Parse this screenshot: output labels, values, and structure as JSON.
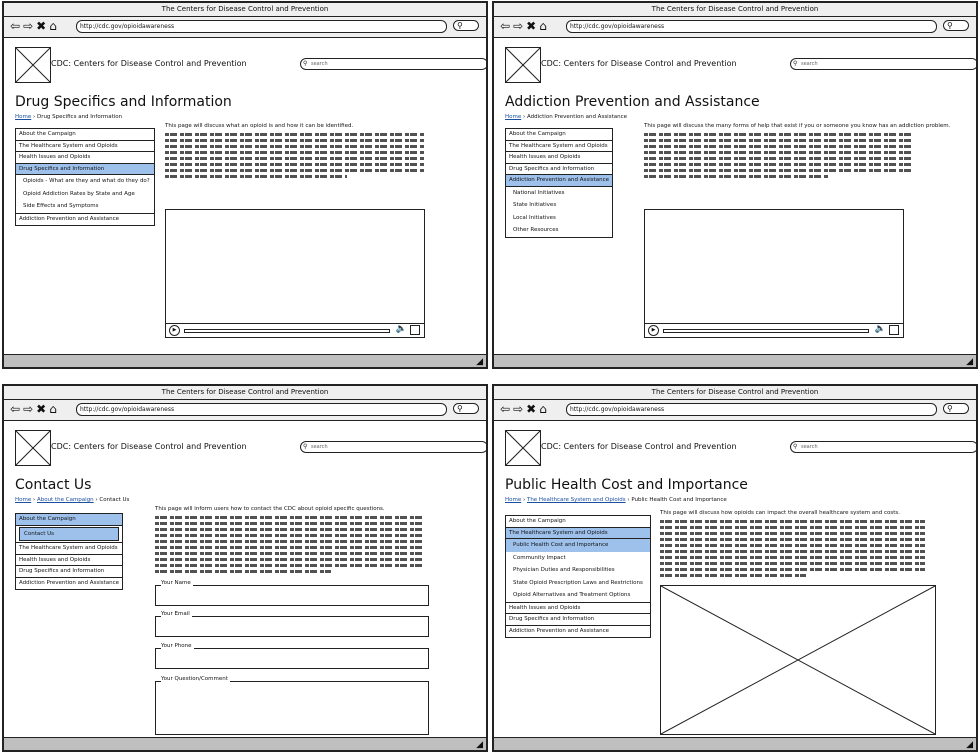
{
  "browser": {
    "title": "The Centers for Disease Control and Prevention",
    "url": "http://cdc.gov/opioidawareness"
  },
  "site": {
    "name": "CDC: Centers for Disease Control and Prevention",
    "search_placeholder": "search"
  },
  "panel1": {
    "heading": "Drug Specifics and Information",
    "crumb_home": "Home",
    "crumb_current": "Drug Specifics and Information",
    "nav": [
      "About the Campaign",
      "The Healthcare System and Opioids",
      "Health Issues and Opioids",
      "Drug Specifics and Information"
    ],
    "sub": [
      "Opioids - What are they and what do they do?",
      "Opioid Addiction Rates by State and Age",
      "Side Effects and Symptoms"
    ],
    "nav_after": [
      "Addiction Prevention and Assistance"
    ],
    "intro": "This page will discuss what an opioid is and how it can be identified."
  },
  "panel2": {
    "heading": "Addiction Prevention and Assistance",
    "crumb_home": "Home",
    "crumb_current": "Addiction Prevention and Assistance",
    "nav": [
      "About the Campaign",
      "The Healthcare System and Opioids",
      "Health Issues and Opioids",
      "Drug Specifics and Information",
      "Addiction Prevention and Assistance"
    ],
    "sub": [
      "National Initiatives",
      "State Initiatives",
      "Local Initiatives",
      "Other Resources"
    ],
    "intro": "This page will discuss the many forms of help that exist if you or someone you know has an addiction problem."
  },
  "panel3": {
    "heading": "Contact Us",
    "crumb_home": "Home",
    "crumb_mid": "About the Campaign",
    "crumb_current": "Contact Us",
    "nav_top": [
      "About the Campaign"
    ],
    "sub": [
      "Contact Us"
    ],
    "nav_after": [
      "The Healthcare System and Opioids",
      "Health Issues and Opioids",
      "Drug Specifics and Information",
      "Addiction Prevention and Assistance"
    ],
    "intro": "This page will inform users how to contact the CDC about opioid specific questions.",
    "fields": [
      "Your Name",
      "Your Email",
      "Your Phone",
      "Your Question/Comment"
    ]
  },
  "panel4": {
    "heading": "Public Health Cost and Importance",
    "crumb_home": "Home",
    "crumb_mid": "The Healthcare System and Opioids",
    "crumb_current": "Public Health Cost and Importance",
    "nav_top": [
      "About the Campaign",
      "The Healthcare System and Opioids"
    ],
    "sub": [
      "Public Health Cost and Importance",
      "Community Impact",
      "Physician Duties and Responsibilities",
      "State Opioid Prescription Laws and Restrictions",
      "Opioid Alternatives and Treatment Options"
    ],
    "nav_after": [
      "Health Issues and Opioids",
      "Drug Specifics and Information",
      "Addiction Prevention and Assistance"
    ],
    "intro": "This page will discuss how opioids can impact the overall healthcare system and costs."
  }
}
